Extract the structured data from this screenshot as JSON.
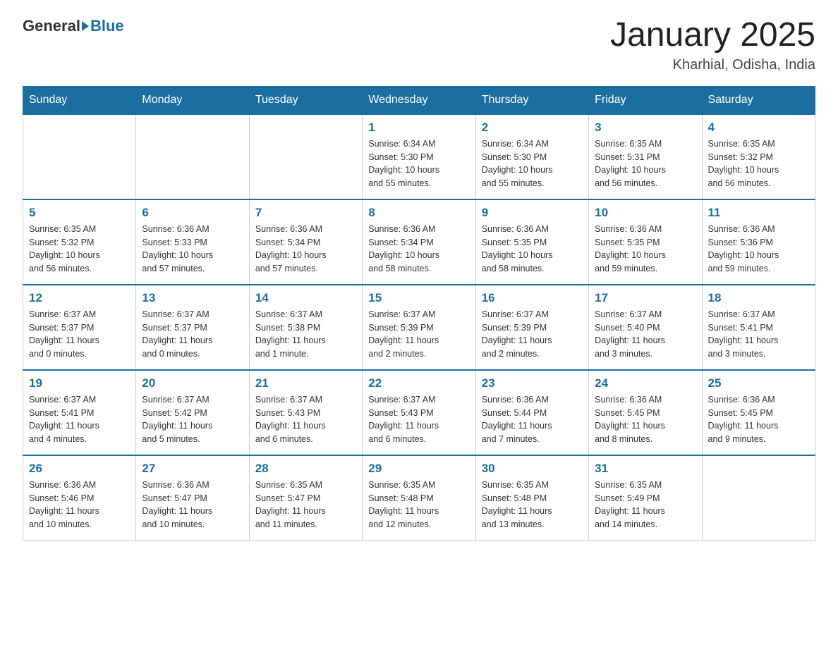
{
  "header": {
    "logo_general": "General",
    "logo_blue": "Blue",
    "title": "January 2025",
    "location": "Kharhial, Odisha, India"
  },
  "days_of_week": [
    "Sunday",
    "Monday",
    "Tuesday",
    "Wednesday",
    "Thursday",
    "Friday",
    "Saturday"
  ],
  "weeks": [
    [
      {
        "day": "",
        "info": ""
      },
      {
        "day": "",
        "info": ""
      },
      {
        "day": "",
        "info": ""
      },
      {
        "day": "1",
        "info": "Sunrise: 6:34 AM\nSunset: 5:30 PM\nDaylight: 10 hours\nand 55 minutes."
      },
      {
        "day": "2",
        "info": "Sunrise: 6:34 AM\nSunset: 5:30 PM\nDaylight: 10 hours\nand 55 minutes."
      },
      {
        "day": "3",
        "info": "Sunrise: 6:35 AM\nSunset: 5:31 PM\nDaylight: 10 hours\nand 56 minutes."
      },
      {
        "day": "4",
        "info": "Sunrise: 6:35 AM\nSunset: 5:32 PM\nDaylight: 10 hours\nand 56 minutes."
      }
    ],
    [
      {
        "day": "5",
        "info": "Sunrise: 6:35 AM\nSunset: 5:32 PM\nDaylight: 10 hours\nand 56 minutes."
      },
      {
        "day": "6",
        "info": "Sunrise: 6:36 AM\nSunset: 5:33 PM\nDaylight: 10 hours\nand 57 minutes."
      },
      {
        "day": "7",
        "info": "Sunrise: 6:36 AM\nSunset: 5:34 PM\nDaylight: 10 hours\nand 57 minutes."
      },
      {
        "day": "8",
        "info": "Sunrise: 6:36 AM\nSunset: 5:34 PM\nDaylight: 10 hours\nand 58 minutes."
      },
      {
        "day": "9",
        "info": "Sunrise: 6:36 AM\nSunset: 5:35 PM\nDaylight: 10 hours\nand 58 minutes."
      },
      {
        "day": "10",
        "info": "Sunrise: 6:36 AM\nSunset: 5:35 PM\nDaylight: 10 hours\nand 59 minutes."
      },
      {
        "day": "11",
        "info": "Sunrise: 6:36 AM\nSunset: 5:36 PM\nDaylight: 10 hours\nand 59 minutes."
      }
    ],
    [
      {
        "day": "12",
        "info": "Sunrise: 6:37 AM\nSunset: 5:37 PM\nDaylight: 11 hours\nand 0 minutes."
      },
      {
        "day": "13",
        "info": "Sunrise: 6:37 AM\nSunset: 5:37 PM\nDaylight: 11 hours\nand 0 minutes."
      },
      {
        "day": "14",
        "info": "Sunrise: 6:37 AM\nSunset: 5:38 PM\nDaylight: 11 hours\nand 1 minute."
      },
      {
        "day": "15",
        "info": "Sunrise: 6:37 AM\nSunset: 5:39 PM\nDaylight: 11 hours\nand 2 minutes."
      },
      {
        "day": "16",
        "info": "Sunrise: 6:37 AM\nSunset: 5:39 PM\nDaylight: 11 hours\nand 2 minutes."
      },
      {
        "day": "17",
        "info": "Sunrise: 6:37 AM\nSunset: 5:40 PM\nDaylight: 11 hours\nand 3 minutes."
      },
      {
        "day": "18",
        "info": "Sunrise: 6:37 AM\nSunset: 5:41 PM\nDaylight: 11 hours\nand 3 minutes."
      }
    ],
    [
      {
        "day": "19",
        "info": "Sunrise: 6:37 AM\nSunset: 5:41 PM\nDaylight: 11 hours\nand 4 minutes."
      },
      {
        "day": "20",
        "info": "Sunrise: 6:37 AM\nSunset: 5:42 PM\nDaylight: 11 hours\nand 5 minutes."
      },
      {
        "day": "21",
        "info": "Sunrise: 6:37 AM\nSunset: 5:43 PM\nDaylight: 11 hours\nand 6 minutes."
      },
      {
        "day": "22",
        "info": "Sunrise: 6:37 AM\nSunset: 5:43 PM\nDaylight: 11 hours\nand 6 minutes."
      },
      {
        "day": "23",
        "info": "Sunrise: 6:36 AM\nSunset: 5:44 PM\nDaylight: 11 hours\nand 7 minutes."
      },
      {
        "day": "24",
        "info": "Sunrise: 6:36 AM\nSunset: 5:45 PM\nDaylight: 11 hours\nand 8 minutes."
      },
      {
        "day": "25",
        "info": "Sunrise: 6:36 AM\nSunset: 5:45 PM\nDaylight: 11 hours\nand 9 minutes."
      }
    ],
    [
      {
        "day": "26",
        "info": "Sunrise: 6:36 AM\nSunset: 5:46 PM\nDaylight: 11 hours\nand 10 minutes."
      },
      {
        "day": "27",
        "info": "Sunrise: 6:36 AM\nSunset: 5:47 PM\nDaylight: 11 hours\nand 10 minutes."
      },
      {
        "day": "28",
        "info": "Sunrise: 6:35 AM\nSunset: 5:47 PM\nDaylight: 11 hours\nand 11 minutes."
      },
      {
        "day": "29",
        "info": "Sunrise: 6:35 AM\nSunset: 5:48 PM\nDaylight: 11 hours\nand 12 minutes."
      },
      {
        "day": "30",
        "info": "Sunrise: 6:35 AM\nSunset: 5:48 PM\nDaylight: 11 hours\nand 13 minutes."
      },
      {
        "day": "31",
        "info": "Sunrise: 6:35 AM\nSunset: 5:49 PM\nDaylight: 11 hours\nand 14 minutes."
      },
      {
        "day": "",
        "info": ""
      }
    ]
  ]
}
